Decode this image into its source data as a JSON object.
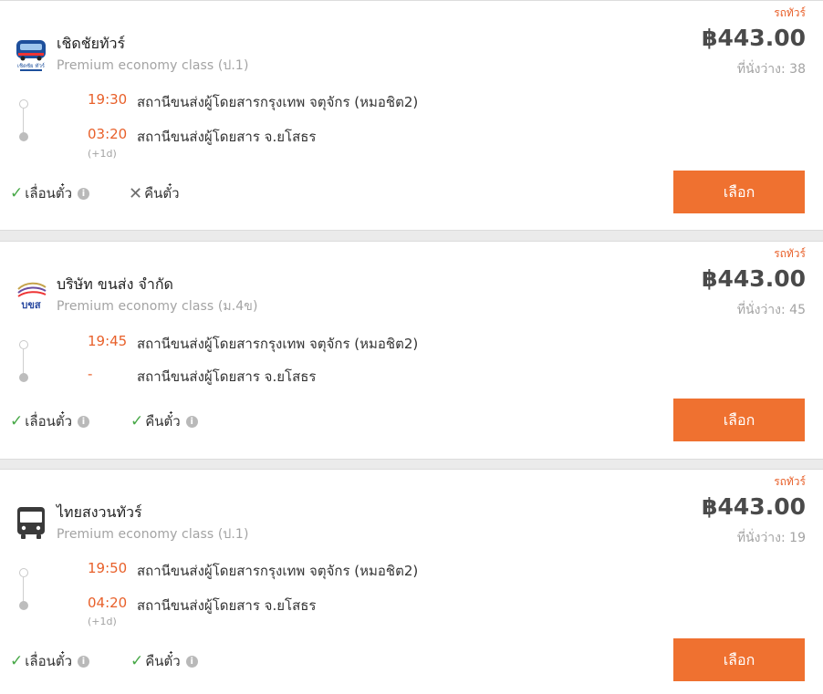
{
  "trips": [
    {
      "tag": "รถทัวร์",
      "operator": "เชิดชัยทัวร์",
      "class_label": "Premium economy class (ป.1)",
      "price": "฿443.00",
      "seats": "ที่นั่งว่าง: 38",
      "depart_time": "19:30",
      "depart_station": "สถานีขนส่งผู้โดยสารกรุงเทพ จตุจักร (หมอชิต2)",
      "arrive_time": "03:20",
      "arrive_station": "สถานีขนส่งผู้โดยสาร จ.ยโสธร",
      "plus_day": "(+1d)",
      "reschedule": "เลื่อนตั๋ว",
      "refund": "คืนตั๋ว",
      "select": "เลือก",
      "logo_text": "เชิดชัย ทัวร์"
    },
    {
      "tag": "รถทัวร์",
      "operator": "บริษัท ขนส่ง จำกัด",
      "class_label": "Premium economy class (ม.4ข)",
      "price": "฿443.00",
      "seats": "ที่นั่งว่าง: 45",
      "depart_time": "19:45",
      "depart_station": "สถานีขนส่งผู้โดยสารกรุงเทพ จตุจักร (หมอชิต2)",
      "arrive_time": "-",
      "arrive_station": "สถานีขนส่งผู้โดยสาร จ.ยโสธร",
      "reschedule": "เลื่อนตั๋ว",
      "refund": "คืนตั๋ว",
      "select": "เลือก",
      "logo_text": "บขส"
    },
    {
      "tag": "รถทัวร์",
      "operator": "ไทยสงวนทัวร์",
      "class_label": "Premium economy class (ป.1)",
      "price": "฿443.00",
      "seats": "ที่นั่งว่าง: 19",
      "depart_time": "19:50",
      "depart_station": "สถานีขนส่งผู้โดยสารกรุงเทพ จตุจักร (หมอชิต2)",
      "arrive_time": "04:20",
      "arrive_station": "สถานีขนส่งผู้โดยสาร จ.ยโสธร",
      "plus_day": "(+1d)",
      "reschedule": "เลื่อนตั๋ว",
      "refund": "คืนตั๋ว",
      "select": "เลือก"
    }
  ],
  "icons": {
    "check": "check-icon",
    "cross": "cross-icon",
    "info": "info-icon",
    "bus": "bus-icon"
  },
  "colors": {
    "accent": "#ef7130",
    "time": "#e8602a",
    "check": "#47a847",
    "muted": "#a3a3a3"
  }
}
